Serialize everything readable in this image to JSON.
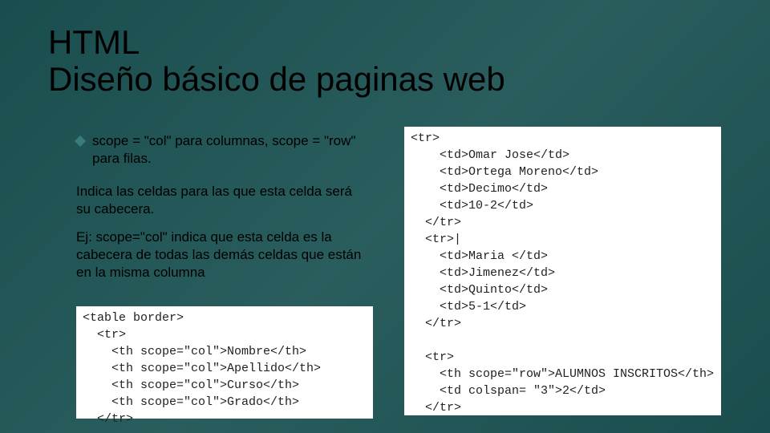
{
  "title": {
    "line1": "HTML",
    "line2": "Diseño básico de paginas web"
  },
  "bullet": {
    "text": "scope = \"col\" para columnas, scope = \"row\" para filas."
  },
  "paragraph1": "Indica las celdas para las que esta celda será su cabecera.",
  "paragraph2": "Ej: scope=\"col\" indica que esta celda es la cabecera de todas las demás celdas que están en la misma columna",
  "code_left": "<table border>\n  <tr>\n    <th scope=\"col\">Nombre</th>\n    <th scope=\"col\">Apellido</th>\n    <th scope=\"col\">Curso</th>\n    <th scope=\"col\">Grado</th>\n  </tr>",
  "code_right": "<tr>\n    <td>Omar Jose</td>\n    <td>Ortega Moreno</td>\n    <td>Decimo</td>\n    <td>10-2</td>\n  </tr>\n  <tr>|\n    <td>Maria </td>\n    <td>Jimenez</td>\n    <td>Quinto</td>\n    <td>5-1</td>\n  </tr>\n\n  <tr>\n    <th scope=\"row\">ALUMNOS INSCRITOS</th>\n    <td colspan= \"3\">2</td>\n  </tr>"
}
